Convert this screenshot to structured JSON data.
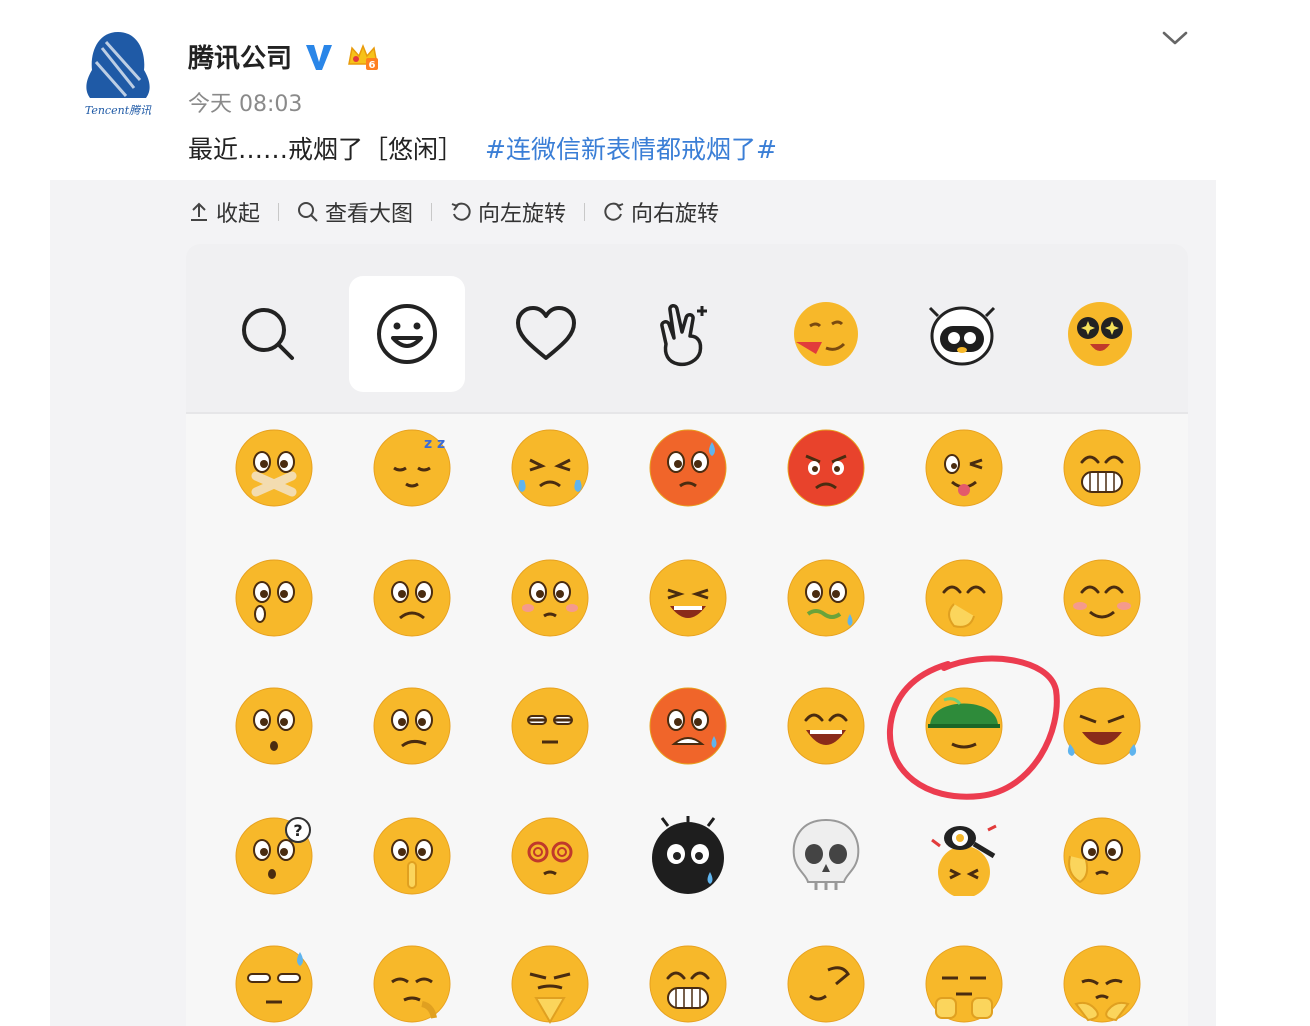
{
  "post": {
    "author": "腾讯公司",
    "time": "今天 08:03",
    "text": "最近……戒烟了［悠闲］",
    "hashtag": "#连微信新表情都戒烟了#",
    "avatar_caption": "Tencent腾讯"
  },
  "toolbar": {
    "collapse": "收起",
    "view_large": "查看大图",
    "rotate_left": "向左旋转",
    "rotate_right": "向右旋转"
  },
  "emoji_panel": {
    "tabs": [
      "search-icon",
      "smiley-icon",
      "heart-icon",
      "gesture-icon",
      "sticker-pack-1",
      "sticker-pack-2",
      "sticker-pack-3"
    ],
    "selected_tab": 1,
    "highlighted_emoji": "leisure (green helmet)"
  },
  "colors": {
    "link": "#3a7ed6",
    "emoji_yellow": "#f7b82a",
    "highlight_circle": "#ec3c4f"
  }
}
